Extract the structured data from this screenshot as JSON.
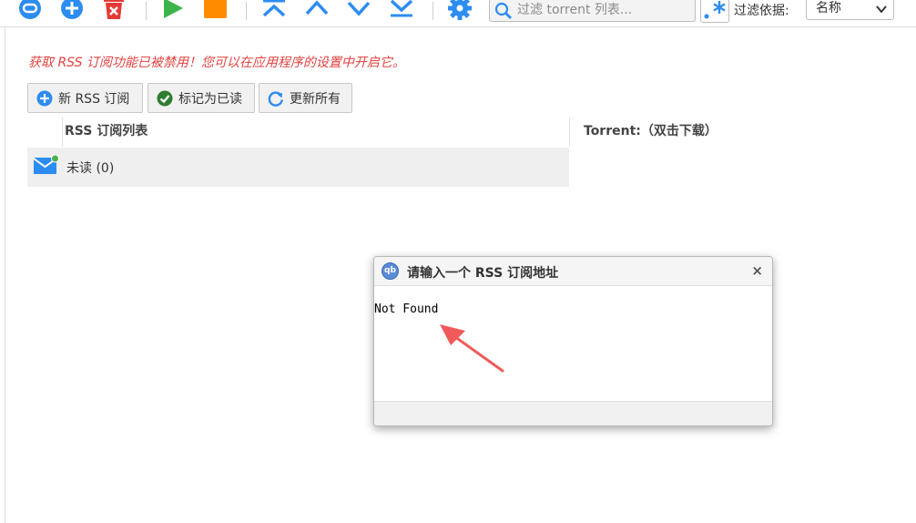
{
  "toolbar": {
    "icons": [
      "link-icon",
      "add-icon",
      "delete-icon",
      "play-icon",
      "stop-icon",
      "move-top-icon",
      "move-up-icon",
      "move-down-icon",
      "move-bottom-icon",
      "settings-icon"
    ],
    "search_placeholder": "过滤 torrent 列表...",
    "filter_label": "过滤依据:",
    "filter_selected": "名称"
  },
  "rss": {
    "notice": "获取 RSS 订阅功能已被禁用！您可以在应用程序的设置中开启它。",
    "buttons": {
      "new_feed": "新 RSS 订阅",
      "mark_read": "标记为已读",
      "update_all": "更新所有"
    },
    "feeds_header": "RSS 订阅列表",
    "torrents_header": "Torrent:（双击下载）",
    "feeds": [
      {
        "label": "未读 (0)"
      }
    ]
  },
  "dialog": {
    "logo_text": "qb",
    "title": "请输入一个 RSS 订阅地址",
    "close": "×",
    "message": "Not Found"
  },
  "colors": {
    "accent_blue": "#2d8cf0",
    "notice_red": "#e0423f",
    "play_green": "#3bb54a",
    "stop_orange": "#ff8c00",
    "delete_red": "#e53935",
    "arrow_red": "#f05a5a"
  }
}
